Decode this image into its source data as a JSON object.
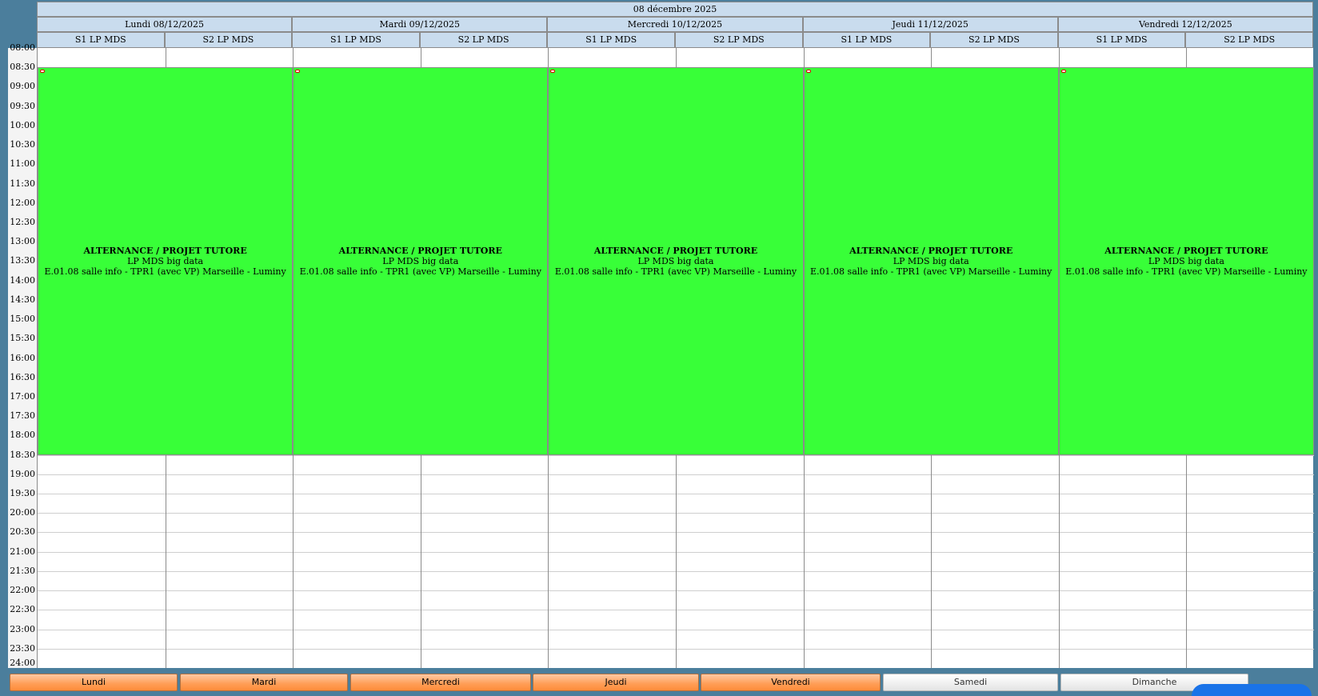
{
  "week_title": "08 décembre 2025",
  "days": [
    {
      "label": "Lundi 08/12/2025",
      "groups": [
        "S1 LP MDS",
        "S2 LP MDS"
      ]
    },
    {
      "label": "Mardi 09/12/2025",
      "groups": [
        "S1 LP MDS",
        "S2 LP MDS"
      ]
    },
    {
      "label": "Mercredi 10/12/2025",
      "groups": [
        "S1 LP MDS",
        "S2 LP MDS"
      ]
    },
    {
      "label": "Jeudi 11/12/2025",
      "groups": [
        "S1 LP MDS",
        "S2 LP MDS"
      ]
    },
    {
      "label": "Vendredi 12/12/2025",
      "groups": [
        "S1 LP MDS",
        "S2 LP MDS"
      ]
    }
  ],
  "times": [
    "08:00",
    "08:30",
    "09:00",
    "09:30",
    "10:00",
    "10:30",
    "11:00",
    "11:30",
    "12:00",
    "12:30",
    "13:00",
    "13:30",
    "14:00",
    "14:30",
    "15:00",
    "15:30",
    "16:00",
    "16:30",
    "17:00",
    "17:30",
    "18:00",
    "18:30",
    "19:00",
    "19:30",
    "20:00",
    "20:30",
    "21:00",
    "21:30",
    "22:00",
    "22:30",
    "23:00",
    "23:30",
    "24:00"
  ],
  "events": [
    {
      "day": 0,
      "start": "08:30",
      "end": "18:30",
      "title": "ALTERNANCE / PROJET TUTORE",
      "group": "LP MDS big data",
      "location": "E.01.08 salle info - TPR1 (avec VP) Marseille - Luminy",
      "color": "#38ff38"
    },
    {
      "day": 1,
      "start": "08:30",
      "end": "18:30",
      "title": "ALTERNANCE / PROJET TUTORE",
      "group": "LP MDS big data",
      "location": "E.01.08 salle info - TPR1 (avec VP) Marseille - Luminy",
      "color": "#38ff38"
    },
    {
      "day": 2,
      "start": "08:30",
      "end": "18:30",
      "title": "ALTERNANCE / PROJET TUTORE",
      "group": "LP MDS big data",
      "location": "E.01.08 salle info - TPR1 (avec VP) Marseille - Luminy",
      "color": "#38ff38"
    },
    {
      "day": 3,
      "start": "08:30",
      "end": "18:30",
      "title": "ALTERNANCE / PROJET TUTORE",
      "group": "LP MDS big data",
      "location": "E.01.08 salle info - TPR1 (avec VP) Marseille - Luminy",
      "color": "#38ff38"
    },
    {
      "day": 4,
      "start": "08:30",
      "end": "18:30",
      "title": "ALTERNANCE / PROJET TUTORE",
      "group": "LP MDS big data",
      "location": "E.01.08 salle info - TPR1 (avec VP) Marseille - Luminy",
      "color": "#38ff38"
    }
  ],
  "tabs": [
    {
      "label": "Lundi",
      "active": true
    },
    {
      "label": "Mardi",
      "active": true
    },
    {
      "label": "Mercredi",
      "active": true
    },
    {
      "label": "Jeudi",
      "active": true
    },
    {
      "label": "Vendredi",
      "active": true
    },
    {
      "label": "Samedi",
      "active": false
    },
    {
      "label": "Dimanche",
      "active": false
    }
  ],
  "colors": {
    "background": "#4b7e9c",
    "header": "#c9dcee",
    "event": "#38ff38",
    "tab_active": "#ff9d55"
  }
}
